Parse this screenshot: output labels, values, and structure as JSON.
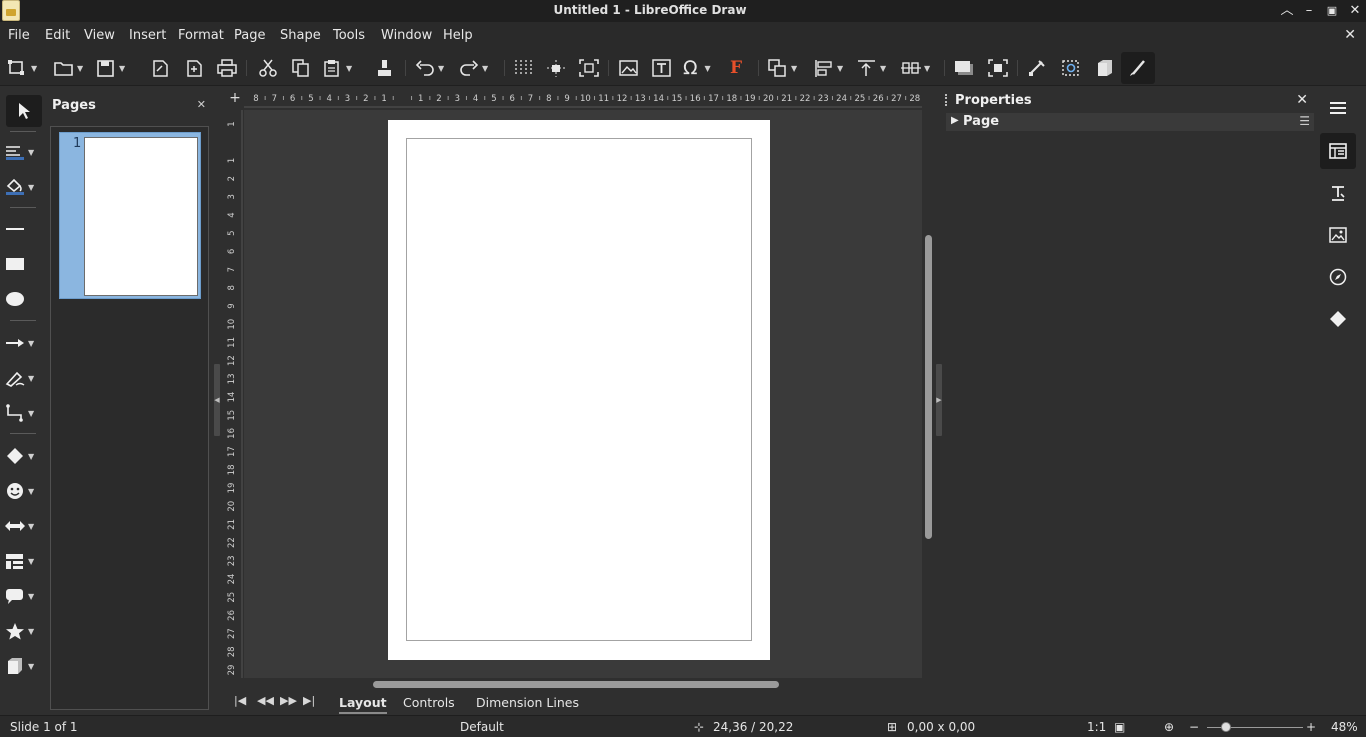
{
  "window": {
    "title": "Untitled 1 - LibreOffice Draw",
    "controls": {
      "minimize": "—",
      "restore": "▫",
      "maximize": "▴",
      "close": "✕"
    }
  },
  "menu": {
    "items": [
      "File",
      "Edit",
      "View",
      "Insert",
      "Format",
      "Page",
      "Shape",
      "Tools",
      "Window",
      "Help"
    ],
    "close_doc": "✕"
  },
  "toolbar": {
    "buttons": [
      "new-shape",
      "open",
      "save",
      "export",
      "export-pdf",
      "print",
      "cut",
      "copy",
      "paste",
      "clone-formatting",
      "undo",
      "redo",
      "grid",
      "helplines",
      "zoom-pan",
      "insert-image",
      "insert-textbox",
      "special-character",
      "fontwork",
      "transformations",
      "align",
      "arrange",
      "distribute",
      "shadow",
      "crop",
      "points",
      "toggle-extrusion",
      "3d-effects",
      "line-and-fill"
    ],
    "special_char_glyph": "Ω",
    "fontwork_glyph": "F",
    "textbox_glyph": "T"
  },
  "pages_panel": {
    "title": "Pages",
    "close": "✕",
    "pages": [
      {
        "number": "1"
      }
    ]
  },
  "rulers": {
    "horizontal": [
      "8",
      "7",
      "6",
      "5",
      "4",
      "3",
      "2",
      "1",
      "",
      "1",
      "2",
      "3",
      "4",
      "5",
      "6",
      "7",
      "8",
      "9",
      "10",
      "11",
      "12",
      "13",
      "14",
      "15",
      "16",
      "17",
      "18",
      "19",
      "20",
      "21",
      "22",
      "23",
      "24",
      "25",
      "26",
      "27",
      "28"
    ],
    "vertical": [
      "1",
      "",
      "1",
      "2",
      "3",
      "4",
      "5",
      "6",
      "7",
      "8",
      "9",
      "10",
      "11",
      "12",
      "13",
      "14",
      "15",
      "16",
      "17",
      "18",
      "19",
      "20",
      "21",
      "22",
      "23",
      "24",
      "25",
      "26",
      "27",
      "28",
      "29"
    ]
  },
  "layer_tabs": {
    "tabs": [
      "Layout",
      "Controls",
      "Dimension Lines"
    ],
    "active": "Layout"
  },
  "properties": {
    "title": "Properties",
    "close": "✕",
    "deck": "Page"
  },
  "sidebar_tabs": [
    "menu",
    "properties",
    "styles",
    "gallery",
    "navigator",
    "shapes"
  ],
  "status": {
    "slide": "Slide 1 of 1",
    "master": "Default",
    "position": "24,36 / 20,22",
    "size": "0,00 x 0,00",
    "scale": "1:1",
    "zoom": "48%"
  },
  "colors": {
    "background": "#2f2f2f",
    "page": "#ffffff",
    "selection": "#8bb6e0",
    "accent_fontwork": "#e8502a"
  }
}
